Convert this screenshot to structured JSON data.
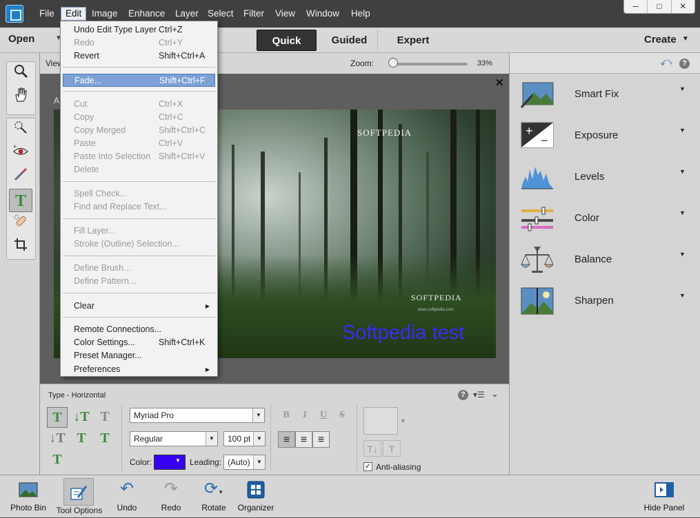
{
  "menubar": {
    "items": [
      "File",
      "Edit",
      "Image",
      "Enhance",
      "Layer",
      "Select",
      "Filter",
      "View",
      "Window",
      "Help"
    ],
    "active": "Edit",
    "window_controls": [
      "─",
      "□",
      "✕"
    ]
  },
  "modebar": {
    "open": "Open",
    "tabs": [
      "Quick",
      "Guided",
      "Expert"
    ],
    "active_tab": "Quick",
    "create": "Create"
  },
  "workspace": {
    "view_label": "View",
    "zoom_label": "Zoom:",
    "zoom_value": "33%",
    "zoom_fraction": 0.0,
    "doc_tab_char": "A",
    "watermark_top": "SOFTPEDIA",
    "watermark_bottom": "SOFTPEDIA",
    "watermark_sub": "www.softpedia.com",
    "photo_text": "Softpedia test",
    "photo_text_color": "#3c2bf4"
  },
  "tool_options": {
    "title": "Type - Horizontal",
    "font_family": "Myriad Pro",
    "font_style": "Regular",
    "font_size": "100 pt",
    "color_label": "Color:",
    "color_value": "#3600f0",
    "leading_label": "Leading:",
    "leading_value": "(Auto)",
    "anti_alias_label": "Anti-aliasing",
    "anti_alias_checked": true
  },
  "right_panel": {
    "adjustments": [
      "Smart Fix",
      "Exposure",
      "Levels",
      "Color",
      "Balance",
      "Sharpen"
    ]
  },
  "bottombar": {
    "buttons": [
      "Photo Bin",
      "Tool Options",
      "Undo",
      "Redo",
      "Rotate",
      "Organizer"
    ],
    "hide_panel": "Hide Panel"
  },
  "edit_menu": {
    "items": [
      {
        "label": "Undo Edit Type Layer",
        "shortcut": "Ctrl+Z",
        "disabled": false
      },
      {
        "label": "Redo",
        "shortcut": "Ctrl+Y",
        "disabled": true
      },
      {
        "label": "Revert",
        "shortcut": "Shift+Ctrl+A",
        "disabled": false
      },
      {
        "label": "Fade...",
        "shortcut": "Shift+Ctrl+F",
        "disabled": false,
        "highlighted": true
      },
      {
        "label": "Cut",
        "shortcut": "Ctrl+X",
        "disabled": true
      },
      {
        "label": "Copy",
        "shortcut": "Ctrl+C",
        "disabled": true
      },
      {
        "label": "Copy Merged",
        "shortcut": "Shift+Ctrl+C",
        "disabled": true
      },
      {
        "label": "Paste",
        "shortcut": "Ctrl+V",
        "disabled": true
      },
      {
        "label": "Paste Into Selection",
        "shortcut": "Shift+Ctrl+V",
        "disabled": true
      },
      {
        "label": "Delete",
        "shortcut": "",
        "disabled": true
      },
      {
        "label": "Spell Check...",
        "shortcut": "",
        "disabled": true
      },
      {
        "label": "Find and Replace Text...",
        "shortcut": "",
        "disabled": true
      },
      {
        "label": "Fill Layer...",
        "shortcut": "",
        "disabled": true
      },
      {
        "label": "Stroke (Outline) Selection...",
        "shortcut": "",
        "disabled": true
      },
      {
        "label": "Define Brush...",
        "shortcut": "",
        "disabled": true
      },
      {
        "label": "Define Pattern...",
        "shortcut": "",
        "disabled": true
      },
      {
        "label": "Clear",
        "shortcut": "",
        "disabled": false,
        "submenu": true
      },
      {
        "label": "Remote Connections...",
        "shortcut": "",
        "disabled": false
      },
      {
        "label": "Color Settings...",
        "shortcut": "Shift+Ctrl+K",
        "disabled": false
      },
      {
        "label": "Preset Manager...",
        "shortcut": "",
        "disabled": false
      },
      {
        "label": "Preferences",
        "shortcut": "",
        "disabled": false,
        "submenu": true
      }
    ]
  },
  "icons": {
    "submenu_arrow": "▶",
    "dropdown": "▼",
    "close": "✕"
  }
}
